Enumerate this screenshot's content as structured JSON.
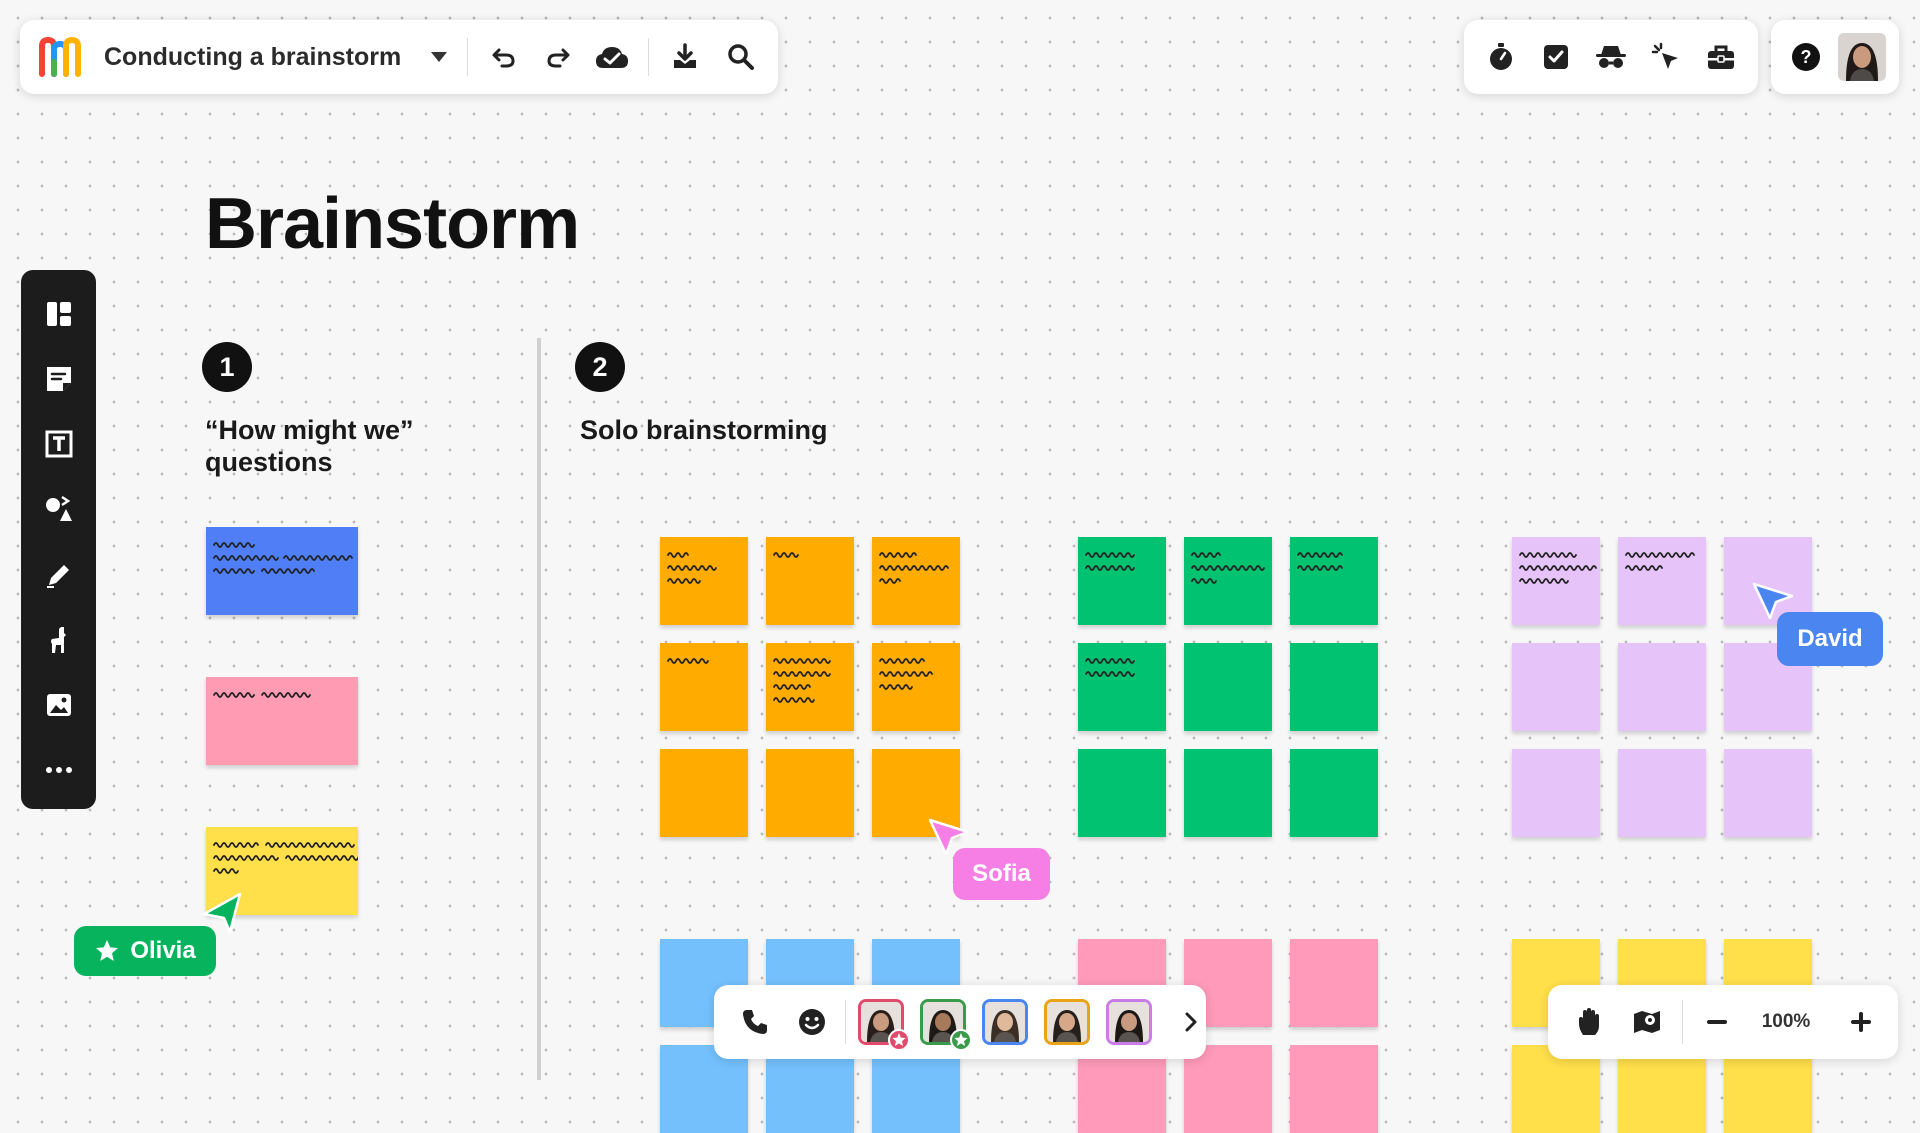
{
  "board": {
    "title": "Conducting a brainstorm"
  },
  "toolbar": {
    "icons": [
      "app-logo",
      "dropdown-caret-icon",
      "undo-icon",
      "redo-icon",
      "cloud-saved-icon",
      "download-icon",
      "search-icon"
    ]
  },
  "top_tools": {
    "icons": [
      "timer-icon",
      "voting-icon",
      "private-mode-icon",
      "attention-cursor-icon",
      "toolkit-icon"
    ]
  },
  "account": {
    "icons": [
      "help-icon",
      "user-avatar"
    ]
  },
  "sidebar": {
    "icons": [
      "templates-icon",
      "sticky-note-icon",
      "text-icon",
      "shapes-icon",
      "pen-icon",
      "llama-icon",
      "image-icon",
      "more-icon"
    ]
  },
  "canvas": {
    "page_title": "Brainstorm",
    "sections": [
      {
        "number": "1",
        "label": "“How might we” questions"
      },
      {
        "number": "2",
        "label": "Solo brainstorming"
      }
    ],
    "sticky_colors": {
      "blue": "#4f7ef7",
      "pink": "#ff9bb3",
      "yellow": "#ffdf4a",
      "orange": "#ffab00",
      "green": "#00c271",
      "lilac": "#e6c3f9",
      "light_blue": "#74c0fd",
      "light_pink": "#ff9aba"
    }
  },
  "cursors": [
    {
      "name": "Olivia",
      "color": "#07b45d"
    },
    {
      "name": "Sofia",
      "color": "#f57fe5"
    },
    {
      "name": "David",
      "color": "#4b86f0"
    }
  ],
  "collab_bar": {
    "icons": [
      "phone-icon",
      "emoji-icon",
      "participant-avatar",
      "participant-avatar",
      "participant-avatar",
      "participant-avatar",
      "participant-avatar",
      "chevron-right-icon"
    ]
  },
  "zoom": {
    "level": "100%",
    "icons": [
      "hand-tool-icon",
      "map-pin-icon",
      "zoom-out-icon",
      "zoom-in-icon"
    ]
  }
}
